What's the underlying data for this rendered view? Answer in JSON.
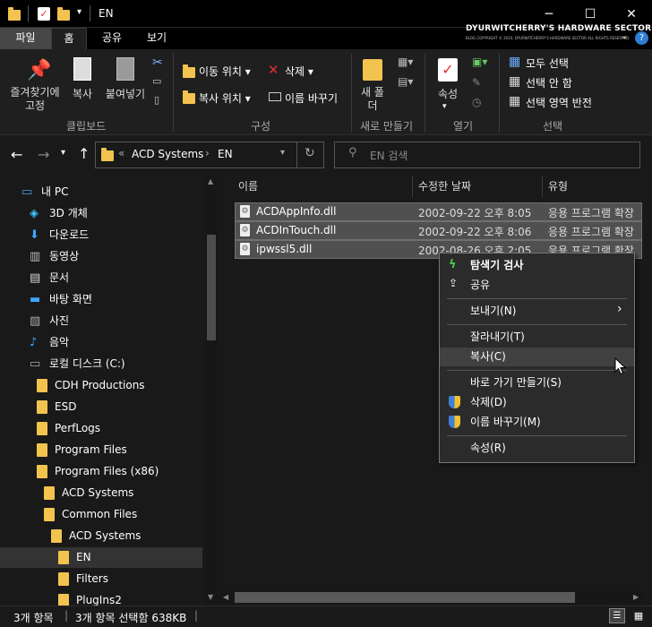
{
  "window": {
    "title": "EN",
    "minimize": "─",
    "maximize": "☐",
    "close": "✕",
    "help": "?"
  },
  "ribbon_tabs": [
    "파일",
    "홈",
    "공유",
    "보기"
  ],
  "banner": {
    "title": "DYURWITCHERRY'S HARDWARE SECTOR",
    "sub": "BLOG COPYRIGHT © 2010, DYURWITCHERRY'S HARDWARE SECTOR ALL RIGHTS RESERVED."
  },
  "ribbon": {
    "pin": "즐겨찾기에 고정",
    "copy": "복사",
    "paste": "붙여넣기",
    "move_to": "이동 위치",
    "copy_to": "복사 위치",
    "delete": "삭제",
    "rename": "이름 바꾸기",
    "new_folder": "새 폴더",
    "properties": "속성",
    "select_all": "모두 선택",
    "select_none": "선택 안 함",
    "invert_select": "선택 영역 반전",
    "groups": {
      "clipboard": "클립보드",
      "organize": "구성",
      "new": "새로 만들기",
      "open": "열기",
      "select": "선택"
    }
  },
  "address": {
    "prefix": "«",
    "path": [
      "ACD Systems",
      "EN"
    ],
    "sep": "›",
    "search_placeholder": "EN 검색"
  },
  "tree": [
    {
      "label": "내 PC",
      "icon": "pc-icon"
    },
    {
      "label": "3D 개체",
      "icon": "cube-icon"
    },
    {
      "label": "다운로드",
      "icon": "download-icon"
    },
    {
      "label": "동영상",
      "icon": "video-icon"
    },
    {
      "label": "문서",
      "icon": "document-icon"
    },
    {
      "label": "바탕 화면",
      "icon": "desktop-icon"
    },
    {
      "label": "사진",
      "icon": "picture-icon"
    },
    {
      "label": "음악",
      "icon": "music-icon"
    },
    {
      "label": "로컬 디스크 (C:)",
      "icon": "drive-icon"
    },
    {
      "label": "CDH Productions",
      "icon": "folder-icon"
    },
    {
      "label": "ESD",
      "icon": "folder-icon"
    },
    {
      "label": "PerfLogs",
      "icon": "folder-icon"
    },
    {
      "label": "Program Files",
      "icon": "folder-icon"
    },
    {
      "label": "Program Files (x86)",
      "icon": "folder-icon"
    },
    {
      "label": "ACD Systems",
      "icon": "folder-icon"
    },
    {
      "label": "Common Files",
      "icon": "folder-icon"
    },
    {
      "label": "ACD Systems",
      "icon": "folder-icon"
    },
    {
      "label": "EN",
      "icon": "folder-icon"
    },
    {
      "label": "Filters",
      "icon": "folder-icon"
    },
    {
      "label": "PlugIns2",
      "icon": "folder-icon"
    }
  ],
  "columns": {
    "name": "이름",
    "date": "수정한 날짜",
    "type": "유형"
  },
  "files": [
    {
      "name": "ACDAppInfo.dll",
      "date": "2002-09-22 오후 8:05",
      "type": "응용 프로그램 확장"
    },
    {
      "name": "ACDInTouch.dll",
      "date": "2002-09-22 오후 8:06",
      "type": "응용 프로그램 확장"
    },
    {
      "name": "ipwssl5.dll",
      "date": "2002-08-26 오후 2:05",
      "type": "응용 프로그램 확장"
    }
  ],
  "context_menu": {
    "scan": "탐색기 검사",
    "share": "공유",
    "send_to": "보내기(N)",
    "cut": "잘라내기(T)",
    "copy": "복사(C)",
    "shortcut": "바로 가기 만들기(S)",
    "delete": "삭제(D)",
    "rename": "이름 바꾸기(M)",
    "properties": "속성(R)"
  },
  "status": {
    "count": "3개 항목",
    "selected": "3개 항목 선택함 638KB"
  },
  "colors": {
    "accent": "#f2c34f",
    "selection": "#505050",
    "menu_bg": "#2b2b2b"
  }
}
